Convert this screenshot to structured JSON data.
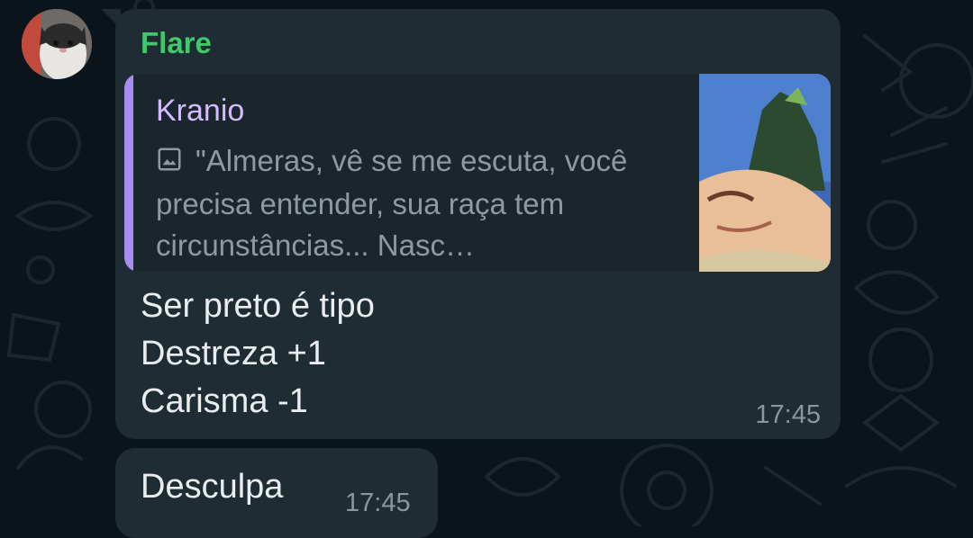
{
  "chat": {
    "wallpaper_color": "#0b141a",
    "bubble_color": "#1f2c34"
  },
  "message_1": {
    "sender": "Flare",
    "sender_color": "#3fc96b",
    "avatar": "cat-avatar",
    "reply": {
      "author": "Kranio",
      "icon": "image-icon",
      "text": "\"Almeras, vê se me escuta, você precisa entender, sua raça tem circunstâncias... Nasc…",
      "accent_color": "#a98cf0"
    },
    "lines": [
      "Ser preto é tipo",
      "Destreza +1",
      "Carisma -1"
    ],
    "time": "17:45"
  },
  "message_2": {
    "text": "Desculpa",
    "time": "17:45"
  }
}
